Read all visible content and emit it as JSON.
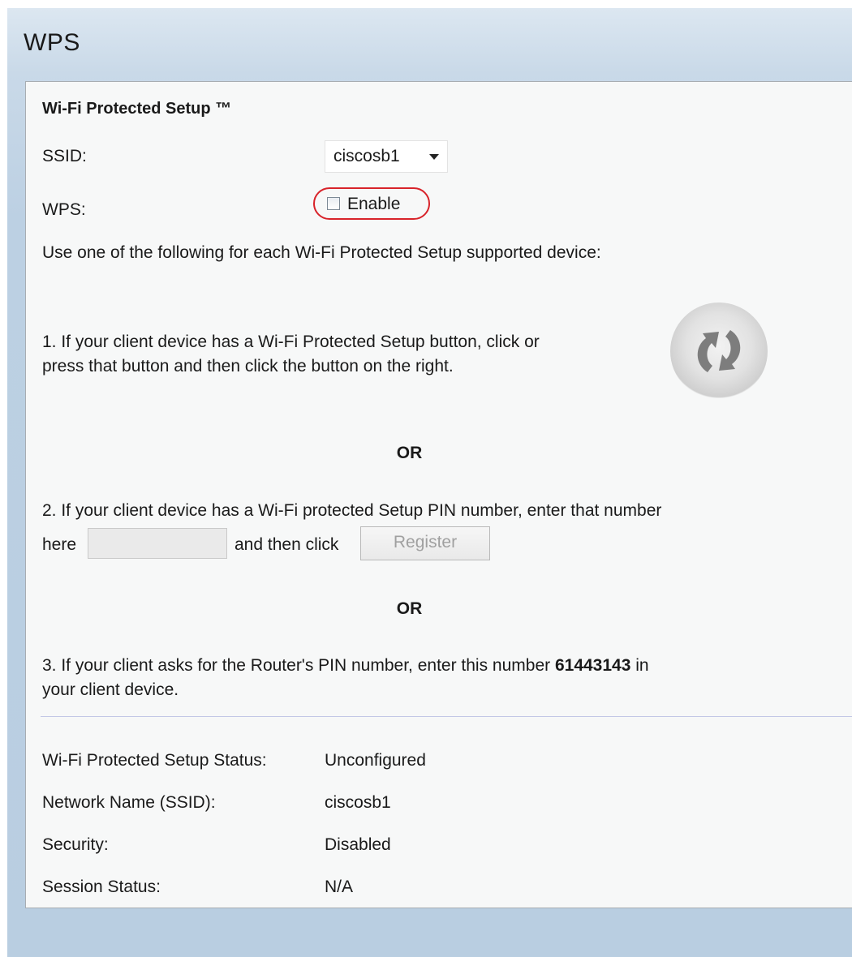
{
  "page": {
    "title": "WPS"
  },
  "panel": {
    "heading": "Wi-Fi Protected Setup ™",
    "ssid_label": "SSID:",
    "ssid_value": "ciscosb1",
    "wps_label": "WPS:",
    "enable_label": "Enable",
    "enable_checked": false,
    "intro": "Use one of the following for each Wi-Fi Protected Setup supported device:",
    "option1_line1": "1. If your client device has a Wi-Fi Protected Setup button, click or",
    "option1_line2": "press that button and then click the button on the right.",
    "or1": "OR",
    "option2_line1": "2. If your client device has a Wi-Fi protected Setup PIN number, enter that number",
    "option2_here": "here",
    "pin_value": "",
    "option2_then": "and then click",
    "register_label": "Register",
    "or2": "OR",
    "option3_line1_pre": "3. If your client asks for the Router's PIN number, enter this number ",
    "router_pin": "61443143",
    "option3_line1_post": " in",
    "option3_line2": "your client device."
  },
  "status": {
    "rows": [
      {
        "label": "Wi-Fi Protected Setup Status:",
        "value": "Unconfigured"
      },
      {
        "label": "Network Name (SSID):",
        "value": "ciscosb1"
      },
      {
        "label": "Security:",
        "value": "Disabled"
      },
      {
        "label": "Session Status:",
        "value": "N/A"
      }
    ]
  },
  "icons": {
    "wps_button": "wps-push-button-icon",
    "ssid_caret": "chevron-down-icon"
  },
  "colors": {
    "highlight_ring": "#d8232a",
    "page_background": "#bcd0e3",
    "panel_background": "#f7f8f8"
  }
}
